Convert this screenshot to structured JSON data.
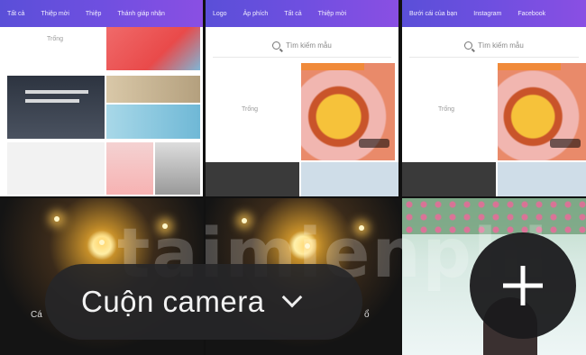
{
  "panels": [
    {
      "nav": [
        "Tất cả",
        "Thiệp mời",
        "Thiệp",
        "Thánh giáp nhận"
      ],
      "blank_label": "Trống"
    },
    {
      "nav": [
        "Logo",
        "Ảp phích",
        "Tất cả",
        "Thiệp mời"
      ],
      "search_placeholder": "Tìm kiếm mẫu",
      "blank_label": "Trống"
    },
    {
      "nav": [
        "Bưới cái của bạn",
        "Instagram",
        "Facebook"
      ],
      "search_placeholder": "Tìm kiếm mẫu",
      "blank_label": "Trống"
    }
  ],
  "camera_roll": {
    "label": "Cuộn camera",
    "left_fragment": "Cá",
    "right_fragment": "ổ"
  },
  "fab": {
    "icon": "plus-icon"
  },
  "watermark": "taimienphi",
  "colors": {
    "topbar": "#6f4fe0",
    "pill": "#262628",
    "fab": "#1a1a1c"
  }
}
